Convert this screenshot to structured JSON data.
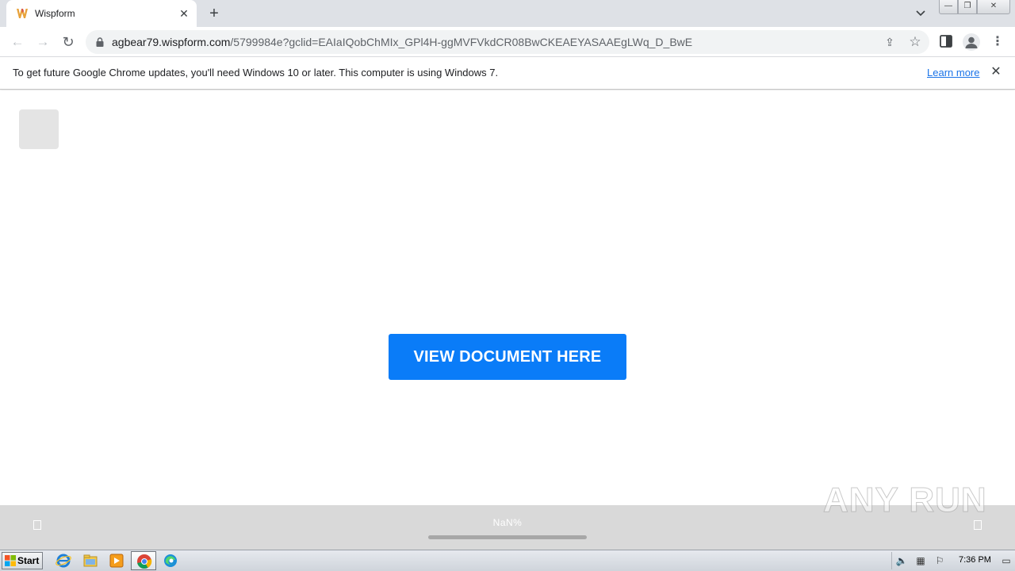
{
  "browser": {
    "tab": {
      "title": "Wispform",
      "close_glyph": "✕"
    },
    "new_tab_glyph": "+",
    "tab_search_glyph": "⌄",
    "window_controls": {
      "minimize": "—",
      "maximize": "❐",
      "close": "✕"
    },
    "toolbar": {
      "back_glyph": "←",
      "forward_glyph": "→",
      "reload_glyph": "↻",
      "url_host": "agbear79.wispform.com",
      "url_path": "/5799984e?gclid=EAIaIQobChMIx_GPl4H-ggMVFVkdCR08BwCKEAEYASAAEgLWq_D_BwE",
      "share_glyph": "⇪",
      "star_glyph": "☆",
      "menu_glyph": "⋮"
    },
    "infobar": {
      "message": "To get future Google Chrome updates, you'll need Windows 10 or later. This computer is using Windows 7.",
      "learn_more": "Learn more",
      "close_glyph": "✕"
    }
  },
  "page": {
    "cta_label": "VIEW DOCUMENT HERE",
    "progress_text": "NaN%",
    "progress_fraction": 0
  },
  "watermark": {
    "text": "ANY RUN"
  },
  "taskbar": {
    "start_label": "Start",
    "clock": "7:36 PM"
  },
  "colors": {
    "accent": "#0a7cf8",
    "link": "#1a73e8",
    "bottom_bar": "#d9d9d9"
  }
}
